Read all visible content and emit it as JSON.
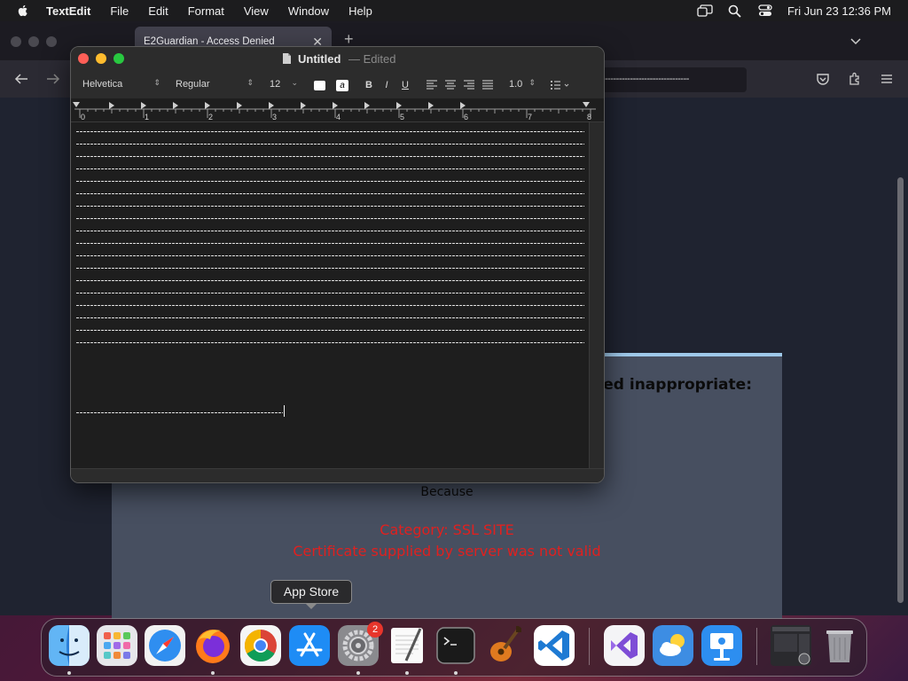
{
  "menubar": {
    "app_name": "TextEdit",
    "items": [
      "File",
      "Edit",
      "Format",
      "View",
      "Window",
      "Help"
    ],
    "clock": "Fri Jun 23  12:36 PM"
  },
  "browser": {
    "tab_title": "E2Guardian - Access Denied",
    "url_text": "------------------------------",
    "page": {
      "message": "med inappropriate:",
      "because": "Because",
      "category": "Category: SSL SITE",
      "reason": "Certificate supplied by server was not valid"
    }
  },
  "textedit": {
    "doc_name": "Untitled",
    "separator": "—",
    "status": "Edited",
    "font_family": "Helvetica",
    "font_style": "Regular",
    "font_size": "12",
    "line_spacing": "1.0",
    "ruler_numbers": [
      "0",
      "1",
      "2",
      "3",
      "4",
      "5",
      "6",
      "7",
      "8"
    ],
    "text_line_count": 19
  },
  "tooltip": {
    "label": "App Store"
  },
  "dock": {
    "apps": [
      {
        "name": "Finder",
        "running": true
      },
      {
        "name": "Launchpad",
        "running": false
      },
      {
        "name": "Safari",
        "running": false
      },
      {
        "name": "Firefox",
        "running": true
      },
      {
        "name": "Google Chrome",
        "running": false
      },
      {
        "name": "App Store",
        "running": false
      },
      {
        "name": "System Settings",
        "running": true,
        "badge": "2"
      },
      {
        "name": "TextEdit",
        "running": true
      },
      {
        "name": "Terminal",
        "running": true
      },
      {
        "name": "GarageBand",
        "running": false
      },
      {
        "name": "Visual Studio Code",
        "running": false
      },
      {
        "name": "Visual Studio",
        "running": false
      },
      {
        "name": "Weather",
        "running": false
      },
      {
        "name": "Keynote",
        "running": false
      },
      {
        "name": "Recent Window",
        "running": false
      },
      {
        "name": "Trash",
        "running": false
      }
    ]
  },
  "colors": {
    "close": "#ff5f57",
    "minimize": "#febc2e",
    "zoom": "#28c840",
    "error_text": "#e0201f",
    "page_header_bar": "#9fc9ea"
  }
}
